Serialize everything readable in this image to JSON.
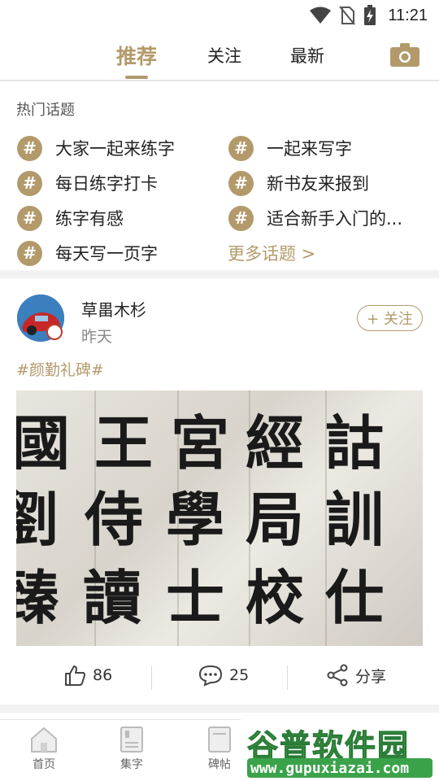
{
  "status_bar": {
    "time": "11:21"
  },
  "top_tabs": [
    {
      "label": "推荐",
      "active": true
    },
    {
      "label": "关注",
      "active": false
    },
    {
      "label": "最新",
      "active": false
    }
  ],
  "hot_topics": {
    "title": "热门话题",
    "items": [
      "大家一起来练字",
      "一起来写字",
      "每日练字打卡",
      "新书友来报到",
      "练字有感",
      "适合新手入门的...",
      "每天写一页字"
    ],
    "more_label": "更多话题 >"
  },
  "post": {
    "username": "草畕木杉",
    "time": "昨天",
    "follow_label": "+ 关注",
    "tag": "#颜勤礼碑#",
    "image_rows": [
      [
        "國",
        "王",
        "宮",
        "經",
        "詁"
      ],
      [
        "劉",
        "侍",
        "學",
        "局",
        "訓"
      ],
      [
        "臻",
        "讀",
        "士",
        "校",
        "仕"
      ]
    ],
    "likes": "86",
    "comments": "25",
    "share_label": "分享"
  },
  "bottom_nav": [
    {
      "label": "首页"
    },
    {
      "label": "集字"
    },
    {
      "label": "碑帖"
    }
  ],
  "watermark": {
    "title": "谷普软件园",
    "url": "www.gupuxiazai.com"
  },
  "colors": {
    "accent": "#b39a6b",
    "watermark_green": "#3aa34a"
  }
}
